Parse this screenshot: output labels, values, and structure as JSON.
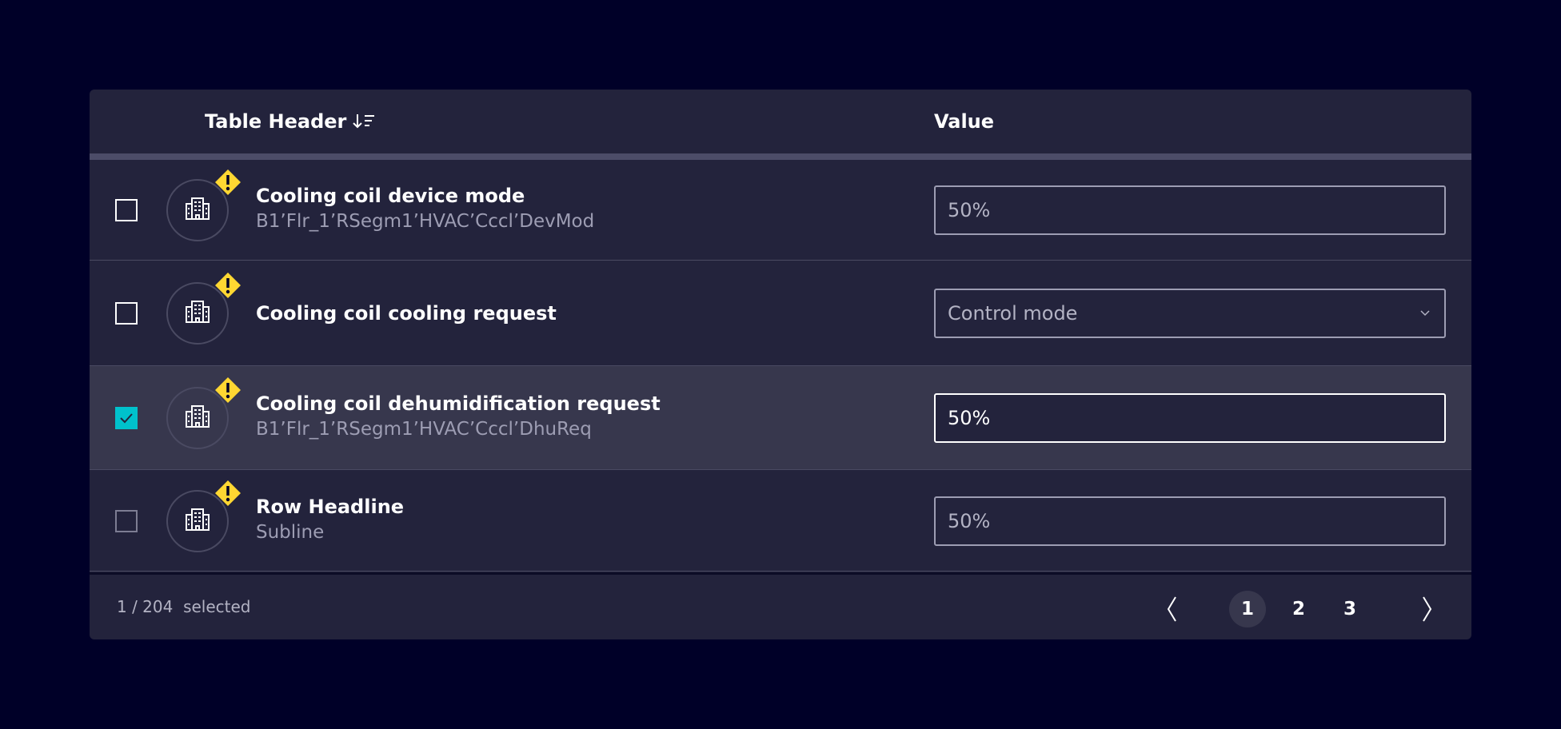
{
  "table": {
    "header": {
      "name_label": "Table Header",
      "value_label": "Value",
      "sort_icon": "sort-descending-icon"
    },
    "rows": [
      {
        "title": "Cooling coil device mode",
        "subtitle": "B1’Flr_1’RSegm1’HVAC’Cccl’DevMod",
        "value": "50%",
        "field_type": "input",
        "checked": false,
        "icon": "building-icon",
        "badge": "warning-icon"
      },
      {
        "title": "Cooling coil cooling request",
        "subtitle": "",
        "value": "Control mode",
        "field_type": "select",
        "checked": false,
        "icon": "building-icon",
        "badge": "warning-icon"
      },
      {
        "title": "Cooling coil dehumidification request",
        "subtitle": "B1’Flr_1’RSegm1’HVAC’Cccl’DhuReq",
        "value": "50%",
        "field_type": "input",
        "checked": true,
        "icon": "building-icon",
        "badge": "warning-icon"
      },
      {
        "title": "Row Headline",
        "subtitle": "Subline",
        "value": "50%",
        "field_type": "input",
        "checked": false,
        "icon": "building-icon",
        "badge": "warning-icon"
      }
    ]
  },
  "footer": {
    "selection_text": "1 / 204  selected",
    "pages": [
      "1",
      "2",
      "3"
    ],
    "current_page": "1"
  },
  "colors": {
    "background": "#000028",
    "card": "#23233c",
    "selected_row": "#37374d",
    "checkbox_checked": "#00c1cc",
    "warning": "#ffd732"
  }
}
